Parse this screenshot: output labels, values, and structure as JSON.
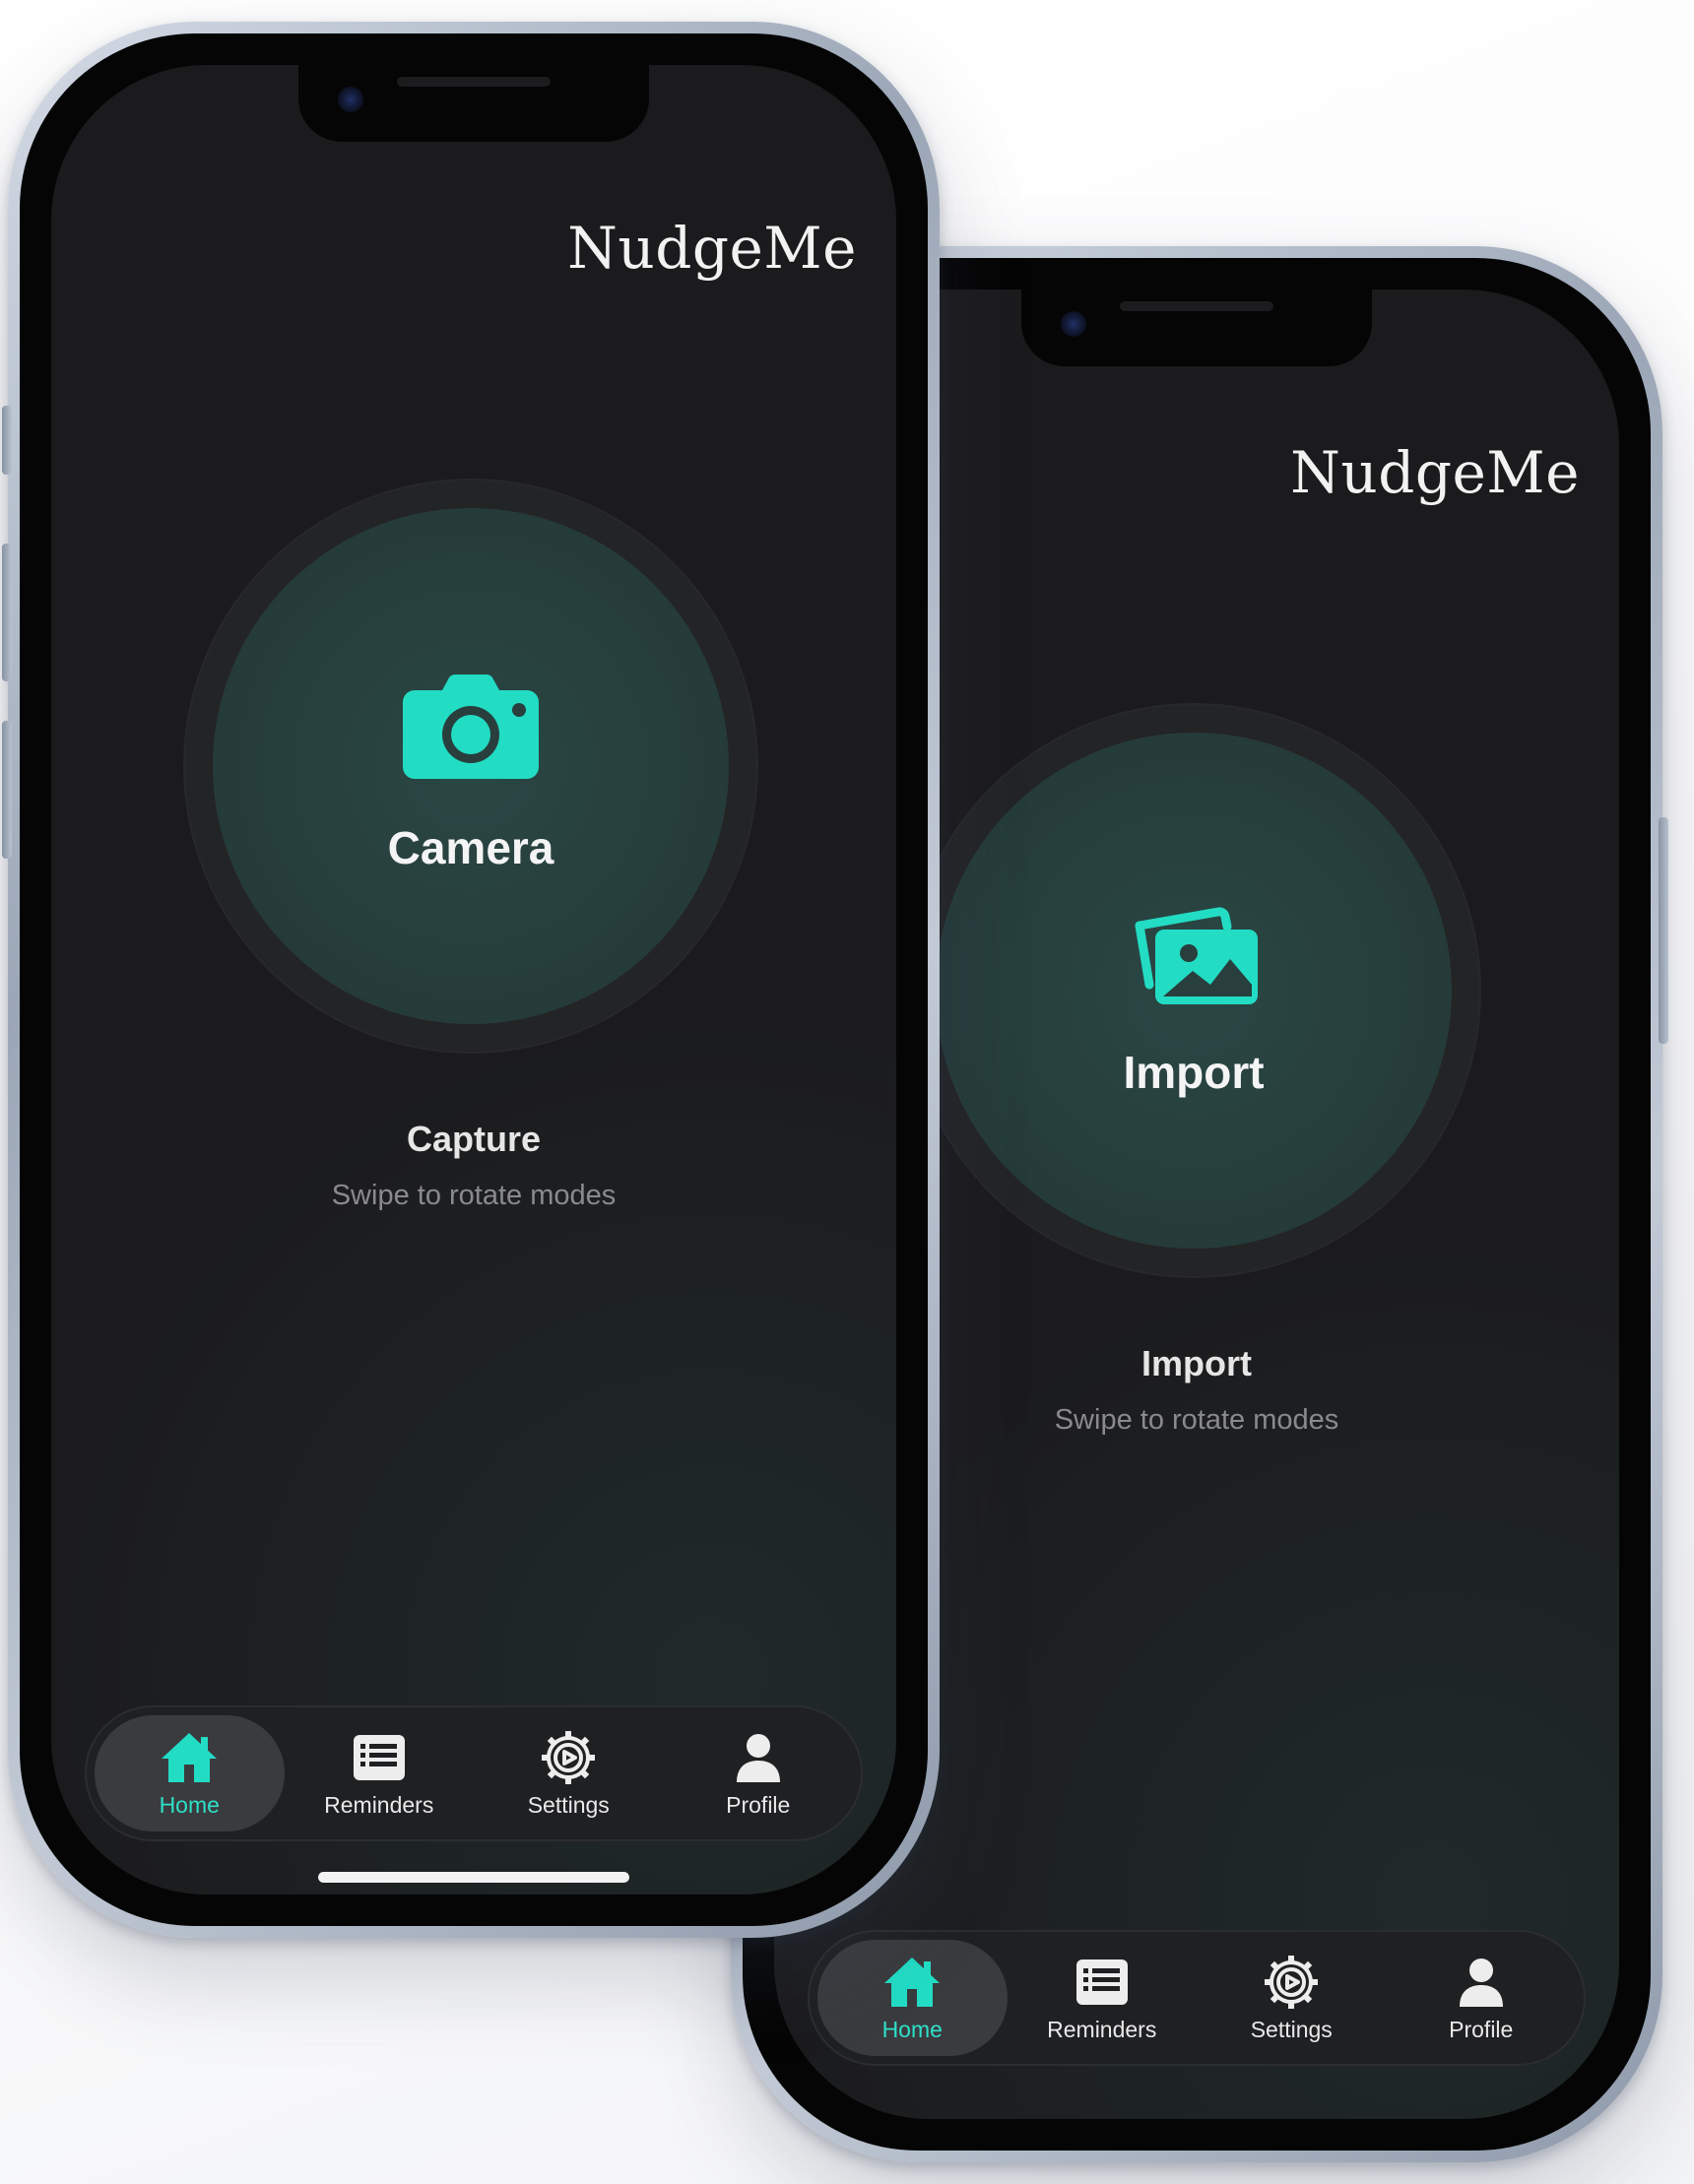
{
  "app": {
    "brand": "NudgeMe"
  },
  "colors": {
    "accent": "#22DCC4",
    "screen_bg": "#1B1B1D",
    "mode_circle": "#283F3D"
  },
  "screens": [
    {
      "mode": {
        "icon": "camera-icon",
        "label": "Camera",
        "title": "Capture",
        "hint": "Swipe to rotate modes"
      },
      "tabs": [
        {
          "label": "Home",
          "icon": "home-icon",
          "active": true
        },
        {
          "label": "Reminders",
          "icon": "list-icon",
          "active": false
        },
        {
          "label": "Settings",
          "icon": "gear-icon",
          "active": false
        },
        {
          "label": "Profile",
          "icon": "person-icon",
          "active": false
        }
      ]
    },
    {
      "mode": {
        "icon": "photos-icon",
        "label": "Import",
        "title": "Import",
        "hint": "Swipe to rotate modes"
      },
      "tabs": [
        {
          "label": "Home",
          "icon": "home-icon",
          "active": true
        },
        {
          "label": "Reminders",
          "icon": "list-icon",
          "active": false
        },
        {
          "label": "Settings",
          "icon": "gear-icon",
          "active": false
        },
        {
          "label": "Profile",
          "icon": "person-icon",
          "active": false
        }
      ]
    }
  ]
}
